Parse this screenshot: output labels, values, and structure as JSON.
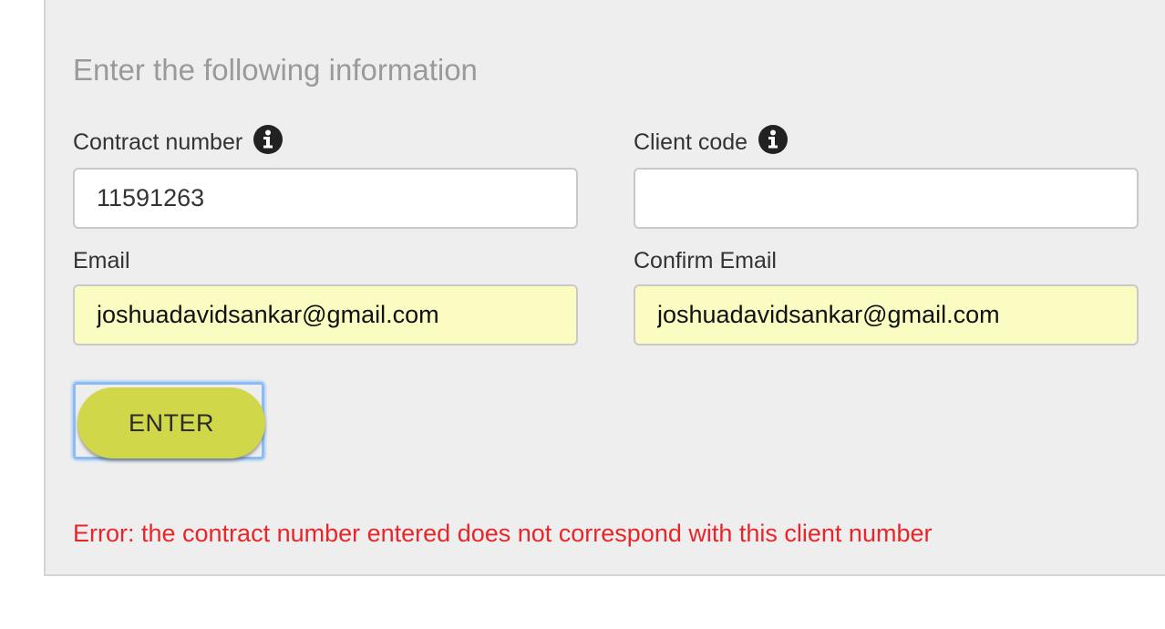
{
  "form": {
    "heading": "Enter the following information",
    "contract_number": {
      "label": "Contract number",
      "value": "11591263",
      "placeholder": ""
    },
    "client_code": {
      "label": "Client code",
      "value": "",
      "placeholder": ""
    },
    "email": {
      "label": "Email",
      "value": "joshuadavidsankar@gmail.com",
      "placeholder": ""
    },
    "confirm_email": {
      "label": "Confirm Email",
      "value": "joshuadavidsankar@gmail.com",
      "placeholder": ""
    },
    "enter_label": "ENTER",
    "error_message": "Error: the contract number entered does not correspond with this client number"
  },
  "icons": {
    "contract_info": "info-circle-icon",
    "client_info": "info-circle-icon"
  },
  "colors": {
    "panel_background": "#eeeeee",
    "button": "#d0d84a",
    "focus_ring": "#8cbcf4",
    "autofill_background": "#fafcc1",
    "error": "#e8262a",
    "heading": "#9a9a9a"
  }
}
